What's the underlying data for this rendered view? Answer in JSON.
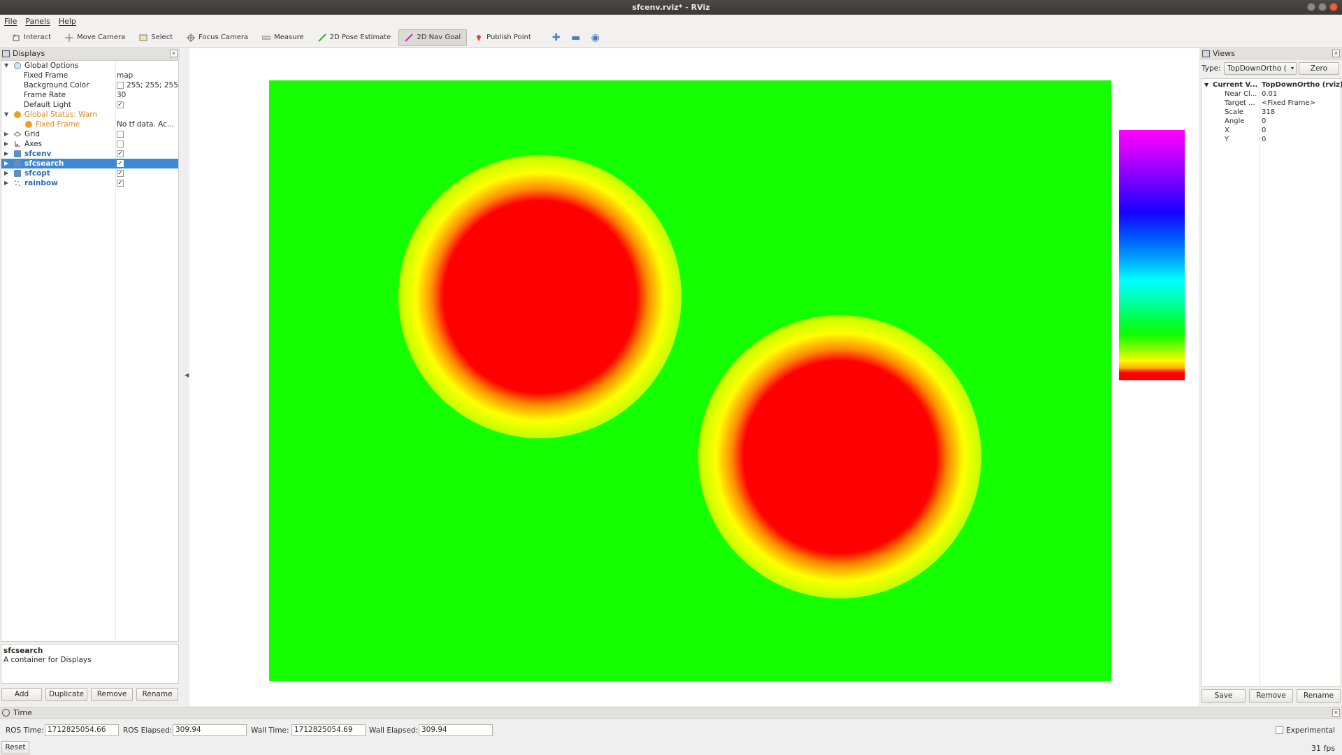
{
  "window": {
    "title": "sfcenv.rviz* - RViz"
  },
  "menu": [
    "File",
    "Panels",
    "Help"
  ],
  "toolbar": {
    "tools": [
      "Interact",
      "Move Camera",
      "Select",
      "Focus Camera",
      "Measure",
      "2D Pose Estimate",
      "2D Nav Goal",
      "Publish Point"
    ],
    "active_tool": "2D Nav Goal",
    "extra_icons": [
      "plus-icon",
      "minus-icon",
      "eye-icon"
    ]
  },
  "displays": {
    "title": "Displays",
    "global_options": {
      "label": "Global Options",
      "fixed_frame_label": "Fixed Frame",
      "fixed_frame_value": "map",
      "bg_color_label": "Background Color",
      "bg_color_value": "255; 255; 255",
      "frame_rate_label": "Frame Rate",
      "frame_rate_value": "30",
      "default_light_label": "Default Light",
      "default_light_checked": true
    },
    "global_status": {
      "label": "Global Status: Warn",
      "fixed_frame_label": "Fixed Frame",
      "fixed_frame_value": "No tf data.  Ac..."
    },
    "items": [
      {
        "label": "Grid",
        "checked": false
      },
      {
        "label": "Axes",
        "checked": false
      },
      {
        "label": "sfcenv",
        "checked": true
      },
      {
        "label": "sfcsearch",
        "checked": true,
        "selected": true
      },
      {
        "label": "sfcopt",
        "checked": true
      },
      {
        "label": "rainbow",
        "checked": true
      }
    ],
    "description": {
      "title": "sfcsearch",
      "text": "A container for Displays"
    },
    "buttons": [
      "Add",
      "Duplicate",
      "Remove",
      "Rename"
    ]
  },
  "views": {
    "title": "Views",
    "type_label": "Type:",
    "type_value": "TopDownOrtho (",
    "zero_button": "Zero",
    "current": {
      "label": "Current V...",
      "value": "TopDownOrtho (rviz)"
    },
    "props": [
      {
        "key": "Near Cl...",
        "value": "0.01"
      },
      {
        "key": "Target ...",
        "value": "<Fixed Frame>"
      },
      {
        "key": "Scale",
        "value": "318"
      },
      {
        "key": "Angle",
        "value": "0"
      },
      {
        "key": "X",
        "value": "0"
      },
      {
        "key": "Y",
        "value": "0"
      }
    ],
    "buttons": [
      "Save",
      "Remove",
      "Rename"
    ]
  },
  "time": {
    "title": "Time",
    "ros_time_label": "ROS Time:",
    "ros_time": "1712825054.66",
    "ros_elapsed_label": "ROS Elapsed:",
    "ros_elapsed": "309.94",
    "wall_time_label": "Wall Time:",
    "wall_time": "1712825054.69",
    "wall_elapsed_label": "Wall Elapsed:",
    "wall_elapsed": "309.94",
    "experimental_label": "Experimental",
    "reset_label": "Reset",
    "fps": "31 fps"
  },
  "colors": {
    "map_free": "#14ff00",
    "obstacle": "#ff0000",
    "selection": "#3d89d4"
  }
}
